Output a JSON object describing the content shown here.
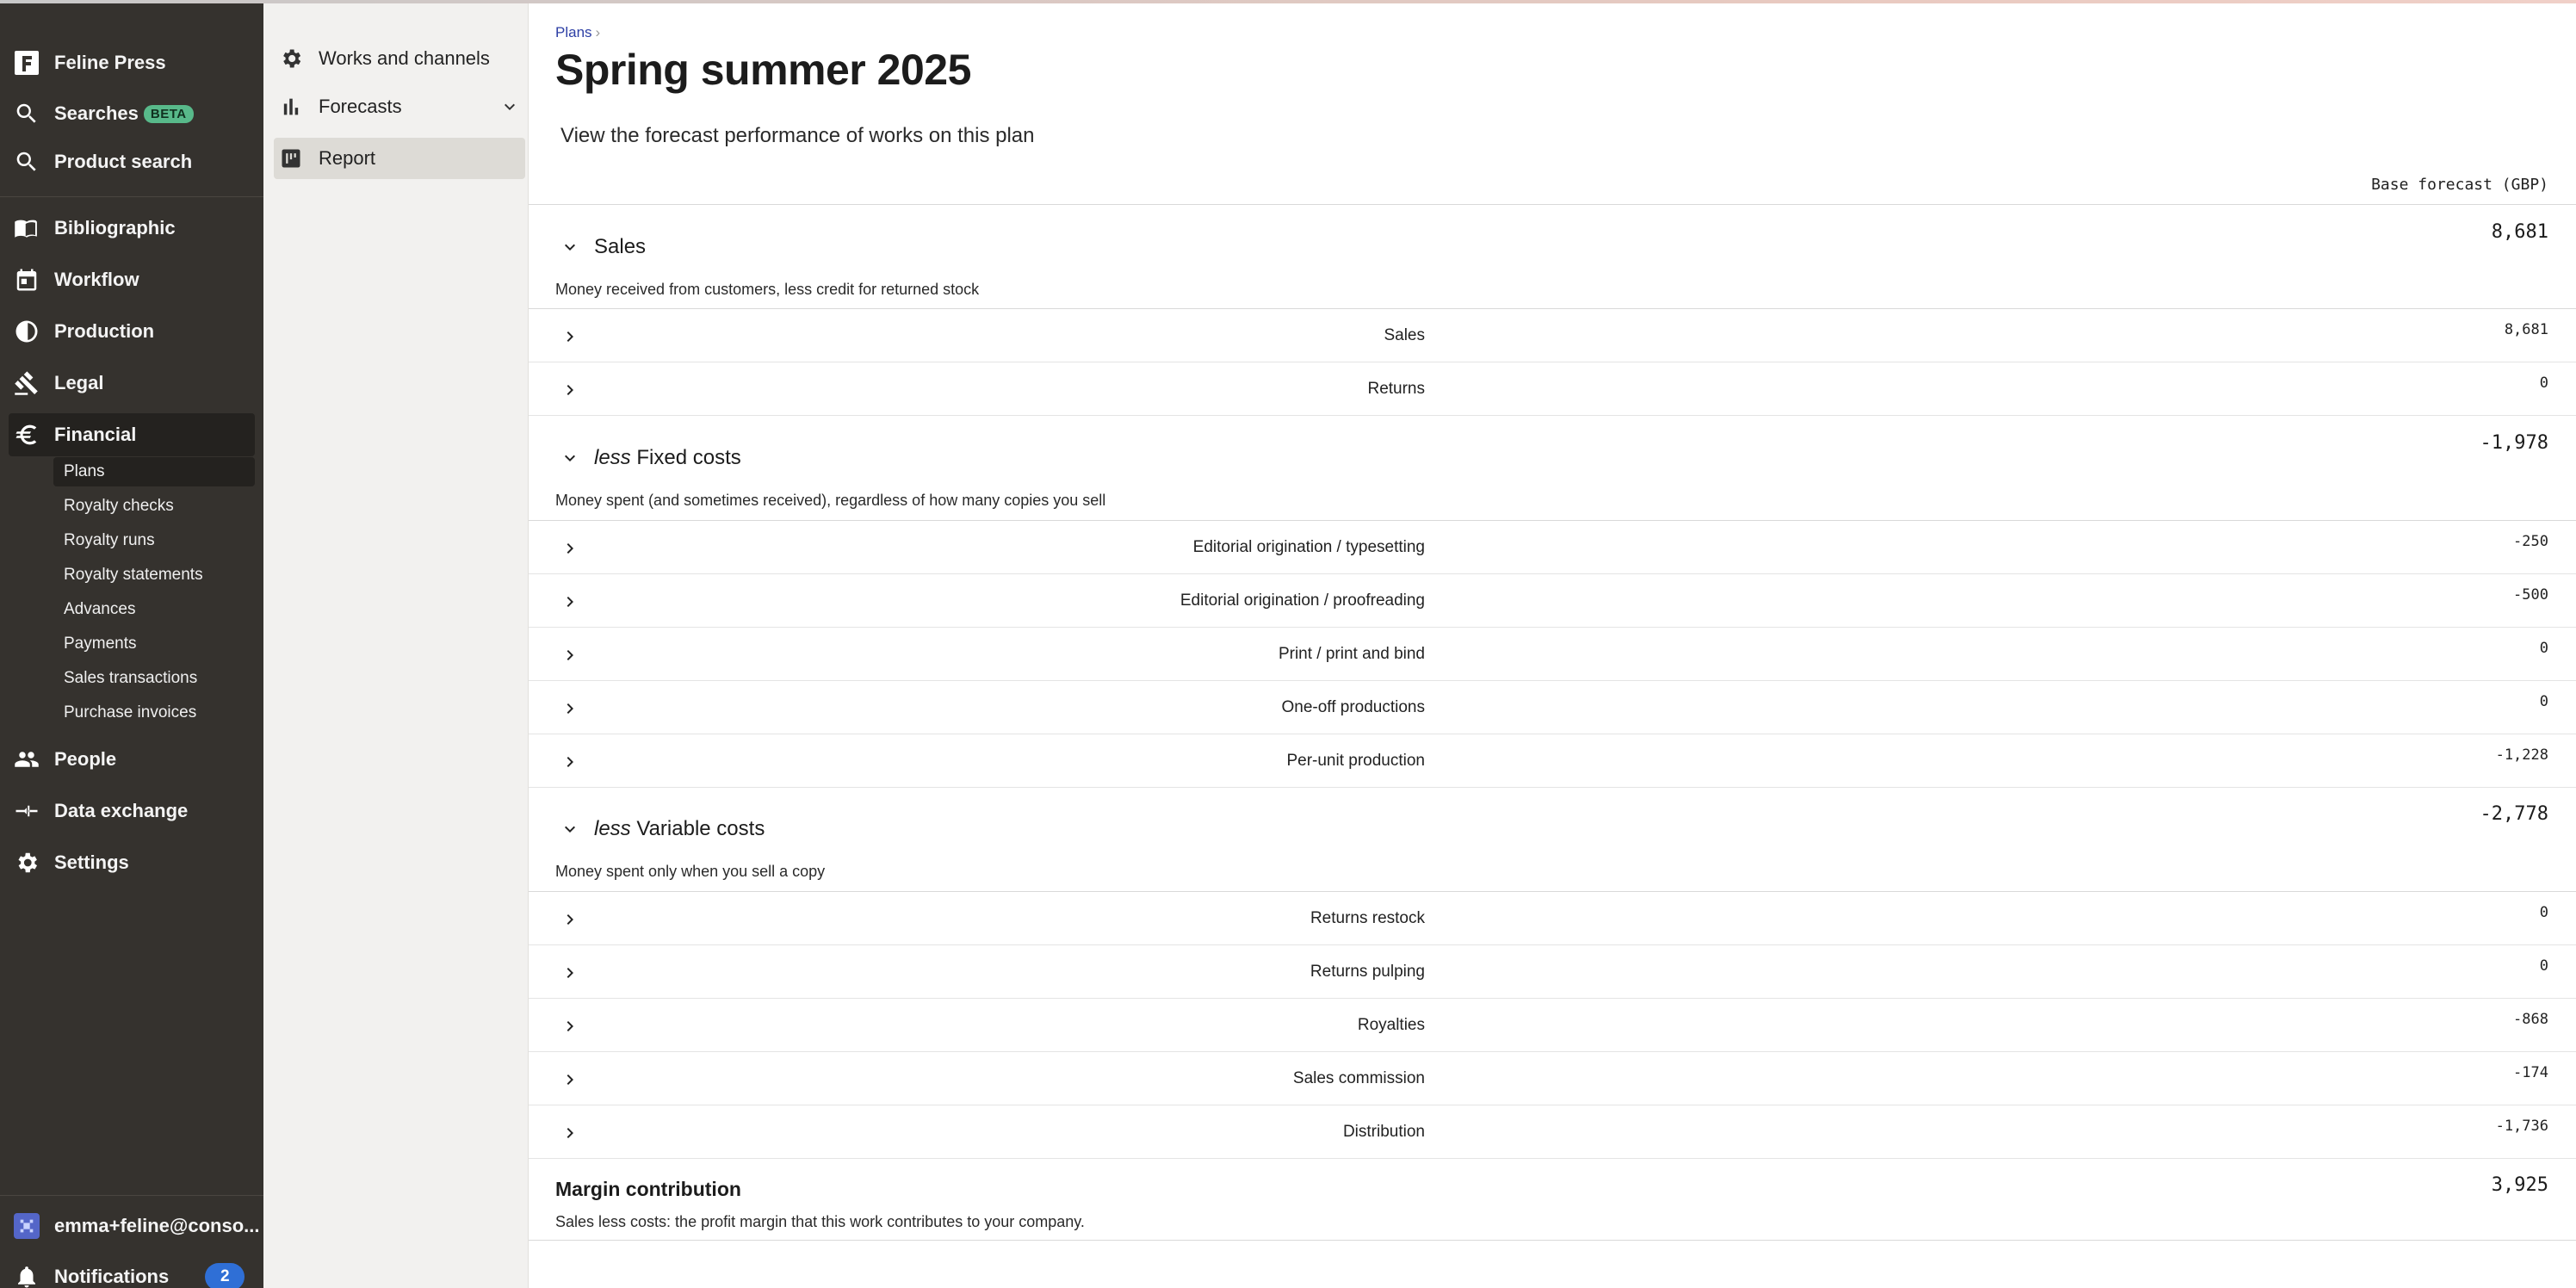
{
  "sidebar": {
    "brand": "Feline Press",
    "searches": "Searches",
    "searches_badge": "BETA",
    "product_search": "Product search",
    "bibliographic": "Bibliographic",
    "workflow": "Workflow",
    "production": "Production",
    "legal": "Legal",
    "financial": "Financial",
    "financial_sub": [
      "Plans",
      "Royalty checks",
      "Royalty runs",
      "Royalty statements",
      "Advances",
      "Payments",
      "Sales transactions",
      "Purchase invoices"
    ],
    "people": "People",
    "data_exchange": "Data exchange",
    "settings": "Settings",
    "user": "emma+feline@conso...",
    "notifications": "Notifications",
    "notifications_count": "2"
  },
  "subpanel": {
    "works_channels": "Works and channels",
    "forecasts": "Forecasts",
    "report": "Report"
  },
  "main": {
    "breadcrumb": "Plans",
    "breadcrumb_sep": "›",
    "title": "Spring summer 2025",
    "description": "View the forecast performance of works on this plan",
    "column_header": "Base forecast (GBP)",
    "sales": {
      "title": "Sales",
      "total": "8,681",
      "description": "Money received from customers, less credit for returned stock",
      "rows": [
        {
          "label": "Sales",
          "value": "8,681"
        },
        {
          "label": "Returns",
          "value": "0"
        }
      ]
    },
    "fixed": {
      "prefix": "less",
      "title": "Fixed costs",
      "total": "-1,978",
      "description": "Money spent (and sometimes received), regardless of how many copies you sell",
      "rows": [
        {
          "label": "Editorial origination / typesetting",
          "value": "-250"
        },
        {
          "label": "Editorial origination / proofreading",
          "value": "-500"
        },
        {
          "label": "Print / print and bind",
          "value": "0"
        },
        {
          "label": "One-off productions",
          "value": "0"
        },
        {
          "label": "Per-unit production",
          "value": "-1,228"
        }
      ]
    },
    "variable": {
      "prefix": "less",
      "title": "Variable costs",
      "total": "-2,778",
      "description": "Money spent only when you sell a copy",
      "rows": [
        {
          "label": "Returns restock",
          "value": "0"
        },
        {
          "label": "Returns pulping",
          "value": "0"
        },
        {
          "label": "Royalties",
          "value": "-868"
        },
        {
          "label": "Sales commission",
          "value": "-174"
        },
        {
          "label": "Distribution",
          "value": "-1,736"
        }
      ]
    },
    "margin": {
      "title": "Margin contribution",
      "total": "3,925",
      "description": "Sales less costs: the profit margin that this work contributes to your company."
    }
  }
}
